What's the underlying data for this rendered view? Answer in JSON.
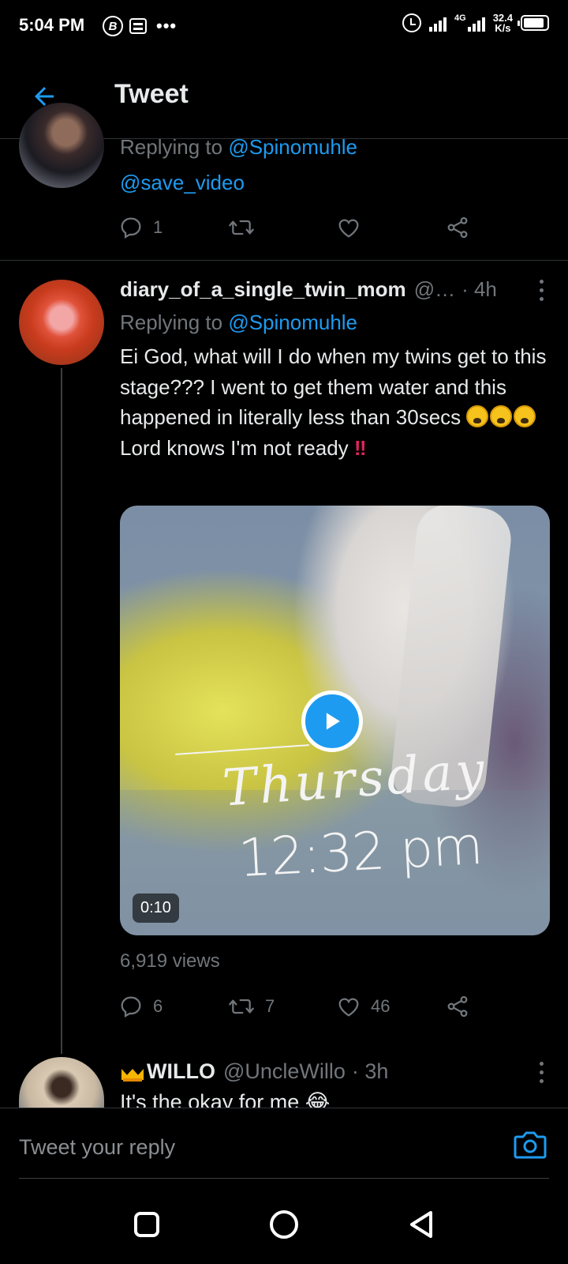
{
  "status_bar": {
    "time": "5:04 PM",
    "left_icons": [
      "bitcoin-b-icon",
      "message-icon",
      "more-notifications-icon"
    ],
    "b_glyph": "B",
    "more": "•••",
    "network_type": "4G",
    "speed_value": "32.4",
    "speed_unit": "K/s",
    "battery_level": 0.9
  },
  "header": {
    "back_icon": "back-arrow-icon",
    "title": "Tweet"
  },
  "tweet_partial": {
    "replying_prefix": "Replying to",
    "replying_to": "@Spinomuhle",
    "mention": "@save_video",
    "reply_count": "1",
    "retweet_count": "",
    "like_count": ""
  },
  "tweet_main": {
    "display_name": "diary_of_a_single_twin_mom",
    "handle": "@…",
    "time": "· 4h",
    "replying_prefix": "Replying to",
    "replying_to": "@Spinomuhle",
    "text_part1": "Ei God, what will I do when my twins get to this stage??? I went to get them water and this happened in literally less than 30secs ",
    "emoji_name": "weary-face-emoji",
    "text_part2": " Lord knows I'm not ready ",
    "bang": "‼",
    "media": {
      "overlay_day": "Thursday",
      "overlay_time": "12:32 pm",
      "duration": "0:10"
    },
    "views": "6,919 views",
    "reply_count": "6",
    "retweet_count": "7",
    "like_count": "46"
  },
  "tweet_next": {
    "display_name": "WILLO",
    "handle": "@UncleWillo",
    "time": "· 3h",
    "text": "It's the okay for me 😂"
  },
  "reply_bar": {
    "placeholder": "Tweet your reply",
    "camera_icon": "camera-icon"
  },
  "colors": {
    "accent": "#1d9bf0",
    "background": "#000000",
    "muted": "#71767b",
    "alert": "#e0245e"
  }
}
